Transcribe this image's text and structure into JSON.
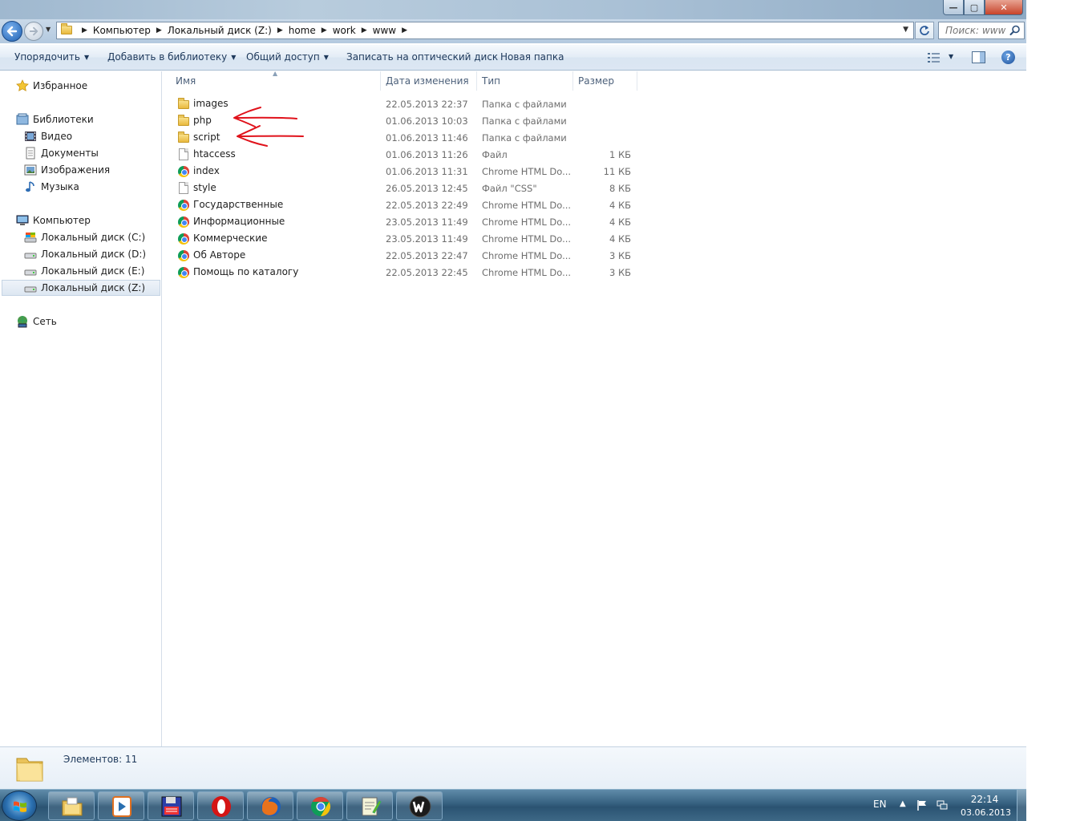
{
  "window": {
    "controls": {
      "minimize": "—",
      "maximize": "▢",
      "close": "✕"
    }
  },
  "nav": {
    "back_icon": "back-arrow-icon",
    "forward_icon": "forward-arrow-icon"
  },
  "address": {
    "breadcrumbs": [
      "Компьютер",
      "Локальный диск (Z:)",
      "home",
      "work",
      "www"
    ]
  },
  "search": {
    "placeholder": "Поиск: www"
  },
  "toolbar": {
    "organize": "Упорядочить",
    "add_to_library": "Добавить в библиотеку",
    "share": "Общий доступ",
    "burn": "Записать на оптический диск",
    "new_folder": "Новая папка",
    "help": "?"
  },
  "sidebar": {
    "favorites": "Избранное",
    "libraries": "Библиотеки",
    "library_items": [
      "Видео",
      "Документы",
      "Изображения",
      "Музыка"
    ],
    "computer": "Компьютер",
    "drives": [
      "Локальный диск (C:)",
      "Локальный диск  (D:)",
      "Локальный диск (E:)",
      "Локальный диск (Z:)"
    ],
    "selected_drive": "Локальный диск (Z:)",
    "network": "Сеть"
  },
  "columns": {
    "name": "Имя",
    "date": "Дата изменения",
    "type": "Тип",
    "size": "Размер"
  },
  "files": [
    {
      "icon": "folder",
      "name": "images",
      "date": "22.05.2013 22:37",
      "type": "Папка с файлами",
      "size": ""
    },
    {
      "icon": "folder",
      "name": "php",
      "date": "01.06.2013 10:03",
      "type": "Папка с файлами",
      "size": ""
    },
    {
      "icon": "folder",
      "name": "script",
      "date": "01.06.2013 11:46",
      "type": "Папка с файлами",
      "size": ""
    },
    {
      "icon": "file",
      "name": "htaccess",
      "date": "01.06.2013 11:26",
      "type": "Файл",
      "size": "1 КБ"
    },
    {
      "icon": "chrome",
      "name": "index",
      "date": "01.06.2013 11:31",
      "type": "Chrome HTML Do...",
      "size": "11 КБ"
    },
    {
      "icon": "file",
      "name": "style",
      "date": "26.05.2013 12:45",
      "type": "Файл \"CSS\"",
      "size": "8 КБ"
    },
    {
      "icon": "chrome",
      "name": "Государственные",
      "date": "22.05.2013 22:49",
      "type": "Chrome HTML Do...",
      "size": "4 КБ"
    },
    {
      "icon": "chrome",
      "name": "Информационные",
      "date": "23.05.2013 11:49",
      "type": "Chrome HTML Do...",
      "size": "4 КБ"
    },
    {
      "icon": "chrome",
      "name": "Коммерческие",
      "date": "23.05.2013 11:49",
      "type": "Chrome HTML Do...",
      "size": "4 КБ"
    },
    {
      "icon": "chrome",
      "name": "Об Авторе",
      "date": "22.05.2013 22:47",
      "type": "Chrome HTML Do...",
      "size": "3 КБ"
    },
    {
      "icon": "chrome",
      "name": "Помощь по каталогу",
      "date": "22.05.2013 22:45",
      "type": "Chrome HTML Do...",
      "size": "3 КБ"
    }
  ],
  "details": {
    "count_text": "Элементов: 11"
  },
  "taskbar": {
    "apps": [
      "explorer",
      "media-player",
      "floppy-save",
      "opera",
      "firefox",
      "chrome",
      "notepad-plus-plus",
      "word"
    ],
    "language": "EN",
    "time": "22:14",
    "date": "03.06.2013"
  },
  "colors": {
    "annotation_red": "#e0121b",
    "accent_blue": "#1e395b"
  }
}
